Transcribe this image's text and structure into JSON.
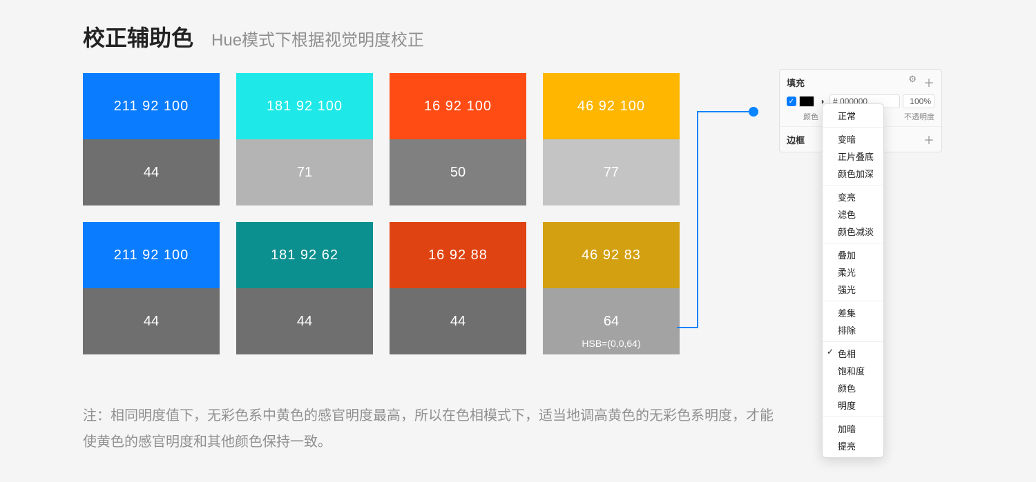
{
  "heading": {
    "title": "校正辅助色",
    "subtitle": "Hue模式下根据视觉明度校正"
  },
  "rows": [
    [
      {
        "top_text": "211 92 100",
        "top_color": "#0a7cff",
        "bottom_text": "44",
        "bottom_color": "#6f6f6f"
      },
      {
        "top_text": "181 92 100",
        "top_color": "#1fe8e8",
        "bottom_text": "71",
        "bottom_color": "#b4b4b4"
      },
      {
        "top_text": "16 92 100",
        "top_color": "#ff4c15",
        "bottom_text": "50",
        "bottom_color": "#808080"
      },
      {
        "top_text": "46 92 100",
        "top_color": "#ffb600",
        "bottom_text": "77",
        "bottom_color": "#c4c4c4"
      }
    ],
    [
      {
        "top_text": "211 92 100",
        "top_color": "#0a7cff",
        "bottom_text": "44",
        "bottom_color": "#6f6f6f"
      },
      {
        "top_text": "181 92 62",
        "top_color": "#0c8f8f",
        "bottom_text": "44",
        "bottom_color": "#6f6f6f"
      },
      {
        "top_text": "16 92 88",
        "top_color": "#e04312",
        "bottom_text": "44",
        "bottom_color": "#6f6f6f"
      },
      {
        "top_text": "46 92 83",
        "top_color": "#d3a011",
        "bottom_text": "64",
        "bottom_color": "#a3a3a3",
        "extra": "HSB=(0,0,64)"
      }
    ]
  ],
  "note": {
    "prefix": "注：",
    "text": "相同明度值下，无彩色系中黄色的感官明度最高，所以在色相模式下，适当地调高黄色的无彩色系明度，才能使黄色的感官明度和其他颜色保持一致。"
  },
  "panel": {
    "fill_label": "填充",
    "border_label": "边框",
    "hex_prefix": "#",
    "hex_value": "000000",
    "opacity_value": "100%",
    "sublabel_left": "颜色",
    "sublabel_right": "不透明度"
  },
  "menu": {
    "groups": [
      [
        "正常"
      ],
      [
        "变暗",
        "正片叠底",
        "颜色加深"
      ],
      [
        "变亮",
        "滤色",
        "颜色减淡"
      ],
      [
        "叠加",
        "柔光",
        "强光"
      ],
      [
        "差集",
        "排除"
      ],
      [
        "色相",
        "饱和度",
        "颜色",
        "明度"
      ],
      [
        "加暗",
        "提亮"
      ]
    ],
    "checked": "色相"
  }
}
